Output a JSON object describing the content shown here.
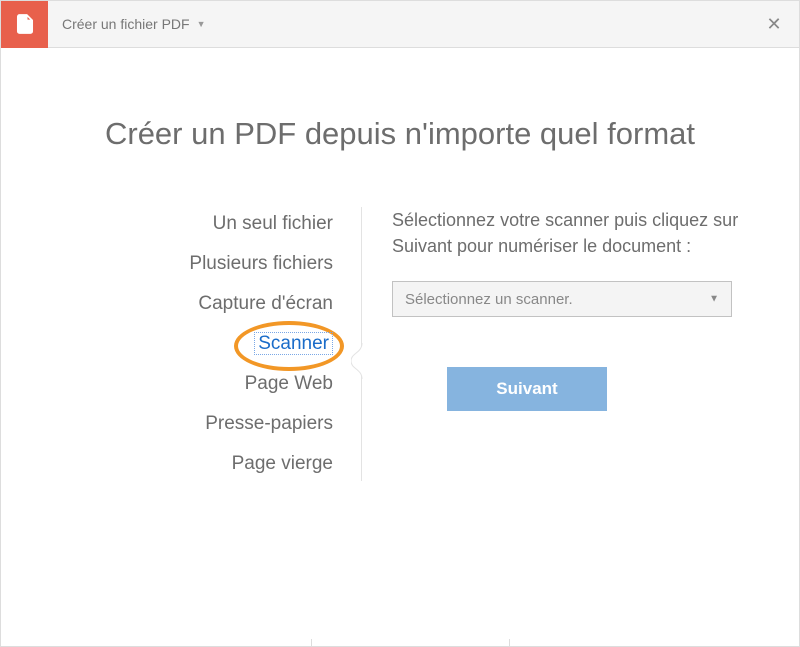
{
  "titlebar": {
    "dropdown_label": "Créer un fichier PDF"
  },
  "page_title": "Créer un PDF depuis n'importe quel format",
  "sidebar": {
    "items": [
      {
        "label": "Un seul fichier"
      },
      {
        "label": "Plusieurs fichiers"
      },
      {
        "label": "Capture d'écran"
      },
      {
        "label": "Scanner"
      },
      {
        "label": "Page Web"
      },
      {
        "label": "Presse-papiers"
      },
      {
        "label": "Page vierge"
      }
    ]
  },
  "panel": {
    "instructions": "Sélectionnez votre scanner puis cliquez sur Suivant pour numériser le document :",
    "dropdown_placeholder": "Sélectionnez un scanner.",
    "next_label": "Suivant"
  }
}
